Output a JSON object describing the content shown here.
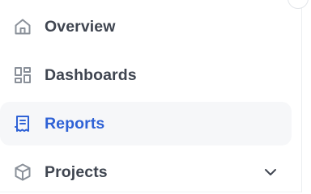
{
  "sidebar": {
    "items": [
      {
        "label": "Overview",
        "icon": "home-icon",
        "active": false
      },
      {
        "label": "Dashboards",
        "icon": "dashboard-grid-icon",
        "active": false
      },
      {
        "label": "Reports",
        "icon": "report-document-icon",
        "active": true
      },
      {
        "label": "Projects",
        "icon": "cube-icon",
        "active": false,
        "expandable": true
      }
    ]
  },
  "colors": {
    "text": "#3f4550",
    "icon": "#8a9099",
    "active_text": "#2f62d6",
    "active_background": "#f6f7f9",
    "divider": "#eceef1"
  }
}
